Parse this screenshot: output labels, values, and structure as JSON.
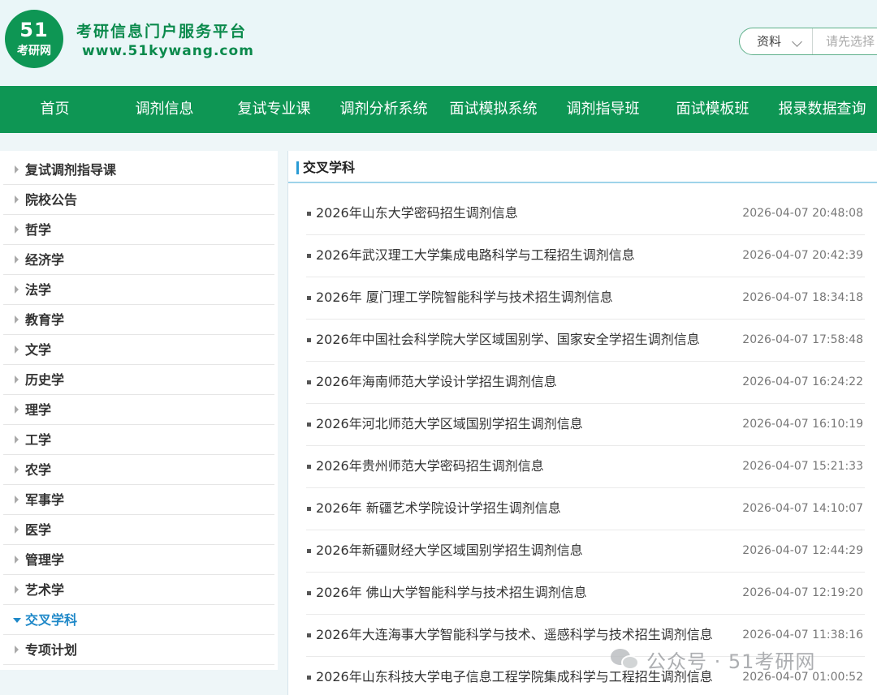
{
  "header": {
    "logo_number": "51",
    "logo_text": "考研网",
    "slogan": "考研信息门户服务平台",
    "site_url": "www.51kywang.com"
  },
  "search": {
    "category": "资料",
    "placeholder": "请先选择"
  },
  "nav": [
    {
      "label": "首页"
    },
    {
      "label": "调剂信息"
    },
    {
      "label": "复试专业课"
    },
    {
      "label": "调剂分析系统"
    },
    {
      "label": "面试模拟系统"
    },
    {
      "label": "调剂指导班"
    },
    {
      "label": "面试模板班"
    },
    {
      "label": "报录数据查询"
    }
  ],
  "sidebar": {
    "active": "交叉学科",
    "items": [
      {
        "label": "复试调剂指导课"
      },
      {
        "label": "院校公告"
      },
      {
        "label": "哲学"
      },
      {
        "label": "经济学"
      },
      {
        "label": "法学"
      },
      {
        "label": "教育学"
      },
      {
        "label": "文学"
      },
      {
        "label": "历史学"
      },
      {
        "label": "理学"
      },
      {
        "label": "工学"
      },
      {
        "label": "农学"
      },
      {
        "label": "军事学"
      },
      {
        "label": "医学"
      },
      {
        "label": "管理学"
      },
      {
        "label": "艺术学"
      },
      {
        "label": "交叉学科"
      },
      {
        "label": "专项计划"
      }
    ]
  },
  "main": {
    "section_title": "交叉学科",
    "articles": [
      {
        "title": "2026年山东大学密码招生调剂信息",
        "time": "2026-04-07 20:48:08"
      },
      {
        "title": "2026年武汉理工大学集成电路科学与工程招生调剂信息",
        "time": "2026-04-07 20:42:39"
      },
      {
        "title": "2026年 厦门理工学院智能科学与技术招生调剂信息",
        "time": "2026-04-07 18:34:18"
      },
      {
        "title": "2026年中国社会科学院大学区域国别学、国家安全学招生调剂信息",
        "time": "2026-04-07 17:58:48"
      },
      {
        "title": "2026年海南师范大学设计学招生调剂信息",
        "time": "2026-04-07 16:24:22"
      },
      {
        "title": "2026年河北师范大学区域国别学招生调剂信息",
        "time": "2026-04-07 16:10:19"
      },
      {
        "title": "2026年贵州师范大学密码招生调剂信息",
        "time": "2026-04-07 15:21:33"
      },
      {
        "title": "2026年 新疆艺术学院设计学招生调剂信息",
        "time": "2026-04-07 14:10:07"
      },
      {
        "title": "2026年新疆财经大学区域国别学招生调剂信息",
        "time": "2026-04-07 12:44:29"
      },
      {
        "title": "2026年 佛山大学智能科学与技术招生调剂信息",
        "time": "2026-04-07 12:19:20"
      },
      {
        "title": "2026年大连海事大学智能科学与技术、遥感科学与技术招生调剂信息",
        "time": "2026-04-07 11:38:16"
      },
      {
        "title": "2026年山东科技大学电子信息工程学院集成科学与工程招生调剂信息",
        "time": "2026-04-07 01:00:52"
      }
    ]
  },
  "watermark": {
    "icon": "wechat-icon",
    "text": "公众号 · 51考研网"
  },
  "colors": {
    "brand_green": "#0e9654",
    "accent_blue": "#1e88c8",
    "header_bg": "#eaf6f8"
  }
}
